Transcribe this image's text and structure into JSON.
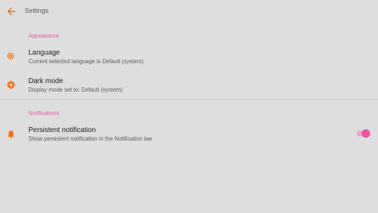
{
  "header": {
    "title": "Settings",
    "back_icon": "arrow-left-icon"
  },
  "accent_color": "#f07018",
  "section_color": "#e35aa1",
  "sections": {
    "appearance": {
      "label": "Appearance",
      "language": {
        "icon": "globe-icon",
        "title": "Language",
        "subtitle": "Current selected language is Default (system)"
      },
      "dark_mode": {
        "icon": "gear-icon",
        "title": "Dark mode",
        "subtitle": "Display mode set to: Default (system)"
      }
    },
    "notifications": {
      "label": "Notifications",
      "persistent": {
        "icon": "bell-icon",
        "title": "Persistent notification",
        "subtitle": "Show persistent notification in the Notification bar",
        "enabled": true
      }
    }
  }
}
